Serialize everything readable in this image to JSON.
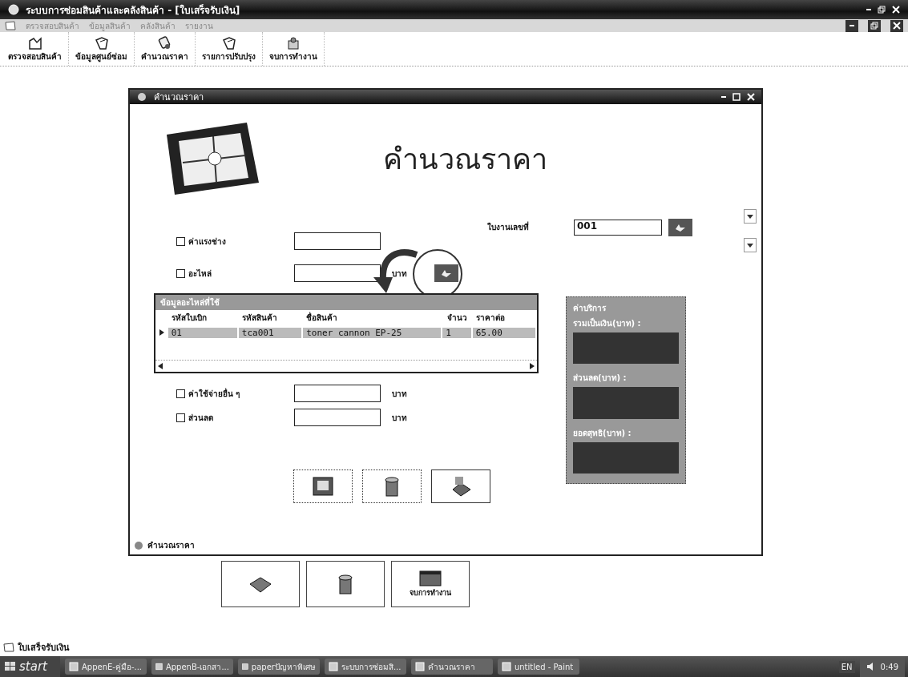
{
  "window": {
    "title": "ระบบการซ่อมสินค้าและคลังสินค้า - [ใบเสร็จรับเงิน]"
  },
  "menu": [
    "ตรวจสอบสินค้า",
    "ข้อมูลสินค้า",
    "คลังสินค้า",
    "รายงาน"
  ],
  "toolbar": [
    "ตรวจสอบสินค้า",
    "ข้อมูลศูนย์ซ่อม",
    "คำนวณราคา",
    "รายการปรับปรุง",
    "จบการทำงาน"
  ],
  "child": {
    "title": "คำนวณราคา",
    "heading": "คำนวณราคา",
    "job_label": "ใบงานเลขที่",
    "job_value": "001",
    "options": [
      {
        "label": "ค่าแรงช่าง",
        "checked": false
      },
      {
        "label": "อะไหล่",
        "checked": false,
        "unit": "บาท"
      }
    ],
    "grid": {
      "caption": "ข้อมูลอะไหล่ที่ใช้",
      "columns": [
        "รหัสใบเบิก",
        "รหัสสินค้า",
        "ชื่อสินค้า",
        "จำนว",
        "ราคาต่อ"
      ],
      "rows": [
        {
          "selected": true,
          "cells": [
            "01",
            "tca001",
            "toner cannon EP-25",
            "1",
            "65.00"
          ]
        }
      ]
    },
    "extras": [
      {
        "label": "ค่าใช้จ่ายอื่น ๆ",
        "checked": false,
        "unit": "บาท"
      },
      {
        "label": "ส่วนลด",
        "checked": false,
        "unit": "บาท"
      }
    ],
    "summary": {
      "title": "ค่าบริการ",
      "fields": [
        "รวมเป็นเงิน(บาท) :",
        "ส่วนลด(บาท) :",
        "ยอดสุทธิ(บาท) :"
      ]
    },
    "status": "คำนวณราคา"
  },
  "end_button_label": "จบการทำงาน",
  "status_bar": "ใบเสร็จรับเงิน",
  "taskbar": {
    "start": "start",
    "tasks": [
      "AppenE-คู่มือ-...",
      "AppenB-เอกสา...",
      "paperปัญหาพิเศษ",
      "ระบบการซ่อมสิ...",
      "คำนวณราคา",
      "untitled - Paint"
    ],
    "lang": "EN",
    "clock": "0:49"
  }
}
